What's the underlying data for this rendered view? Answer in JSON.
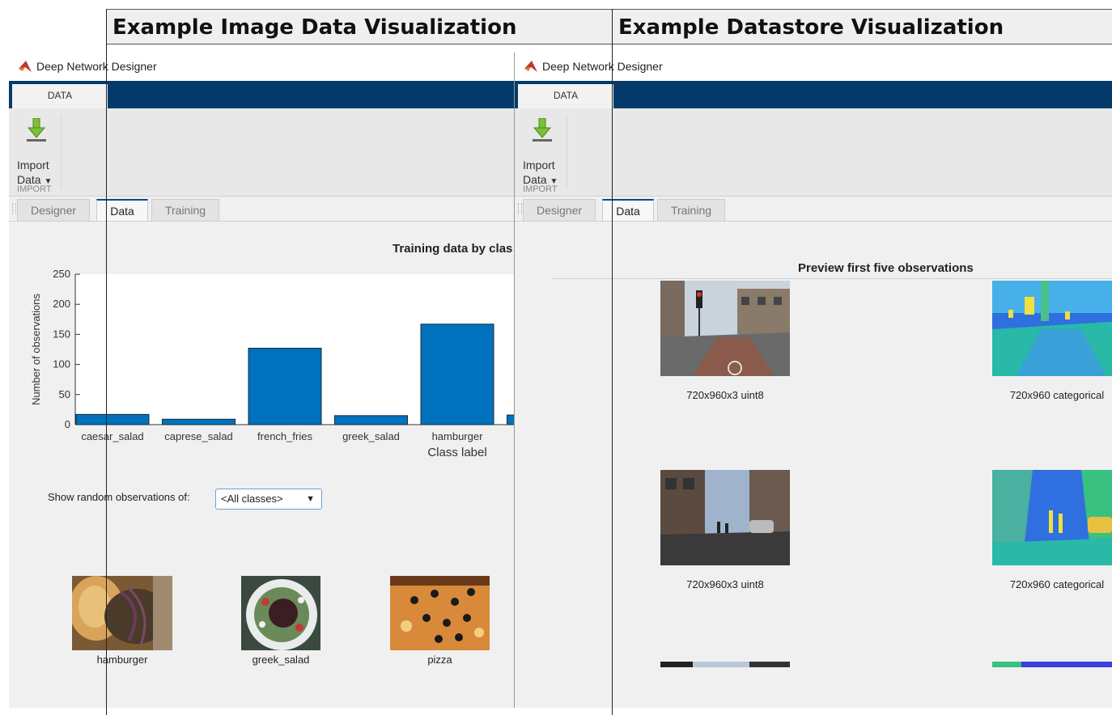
{
  "headers": {
    "left": "Example Image Data Visualization",
    "right": "Example Datastore Visualization"
  },
  "app": {
    "title": "Deep Network Designer",
    "ribbon_tab": "DATA",
    "import_line1": "Import",
    "import_line2": "Data",
    "import_section": "IMPORT",
    "tabs": [
      "Designer",
      "Data",
      "Training"
    ]
  },
  "left_panel": {
    "chart_title": "Training data by clas",
    "show_random_label": "Show random observations of:",
    "class_select_value": "<All classes>",
    "samples": [
      {
        "label": "hamburger"
      },
      {
        "label": "greek_salad"
      },
      {
        "label": "pizza"
      }
    ]
  },
  "chart_data": {
    "type": "bar",
    "title": "Training data by clas",
    "xlabel": "Class label",
    "ylabel": "Number of observations",
    "ylim": [
      0,
      250
    ],
    "yticks": [
      0,
      50,
      100,
      150,
      200,
      250
    ],
    "categories": [
      "caesar_salad",
      "caprese_salad",
      "french_fries",
      "greek_salad",
      "hamburger"
    ],
    "values": [
      17,
      9,
      127,
      15,
      167
    ],
    "grid": false,
    "bar_color": "#0072bd"
  },
  "right_panel": {
    "preview_title": "Preview first five observations",
    "observations": [
      {
        "left_caption": "720x960x3 uint8",
        "right_caption": "720x960 categorical"
      },
      {
        "left_caption": "720x960x3 uint8",
        "right_caption": "720x960 categorical"
      }
    ]
  },
  "colors": {
    "ribbon": "#043b6b",
    "accent": "#0072bd"
  }
}
